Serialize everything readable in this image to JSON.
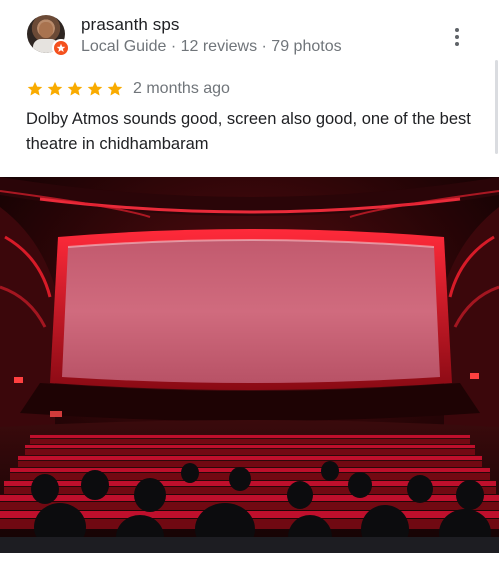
{
  "review": {
    "author_name": "prasanth sps",
    "author_meta": "Local Guide · 12 reviews · 79 photos",
    "rating": 5,
    "date": "2 months ago",
    "text": "Dolby Atmos sounds good, screen also good, one of the best theatre in chidhambaram"
  },
  "icons": {
    "more": "more-vert-icon",
    "star": "star-icon",
    "badge": "local-guide-badge-icon"
  },
  "colors": {
    "star": "#f9ab00",
    "badge": "#f4511e",
    "theatre_red": "#c8102e"
  }
}
